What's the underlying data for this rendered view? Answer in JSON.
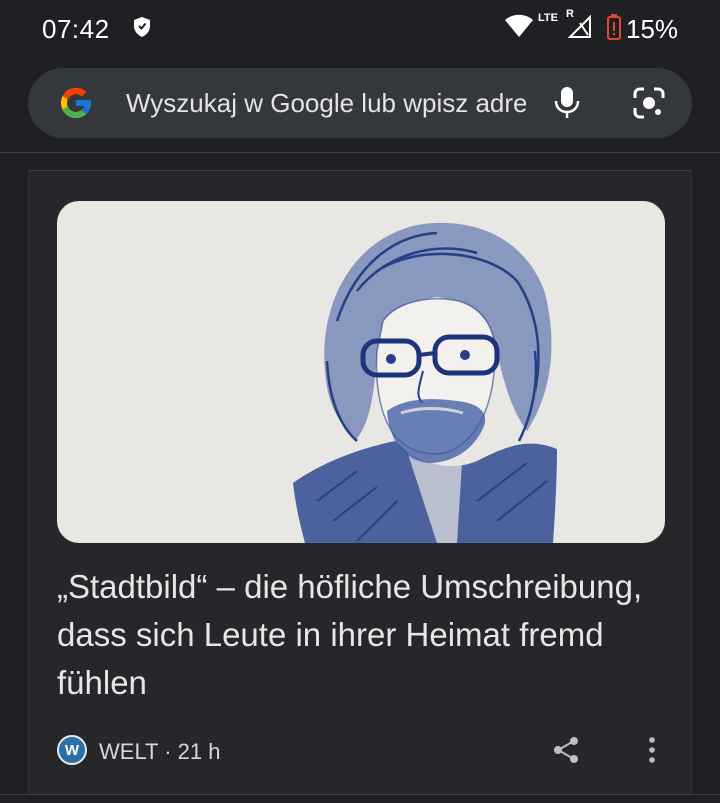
{
  "status_bar": {
    "time": "07:42",
    "network": "LTE",
    "roaming": "R",
    "battery": "15%",
    "icons": [
      "shield-icon",
      "wifi-icon",
      "signal-icon",
      "battery-low-icon"
    ]
  },
  "search": {
    "placeholder": "Wyszukaj w Google lub wpisz adres URL",
    "icons": [
      "google-logo",
      "mic-icon",
      "lens-icon"
    ]
  },
  "card": {
    "headline": "„Stadtbild“ – die höfliche Umschreibung, dass sich Leute in ihrer Heimat fremd fühlen",
    "source_logo": "W",
    "source": "WELT · 21 h",
    "icons": [
      "share-icon",
      "more-vert-icon"
    ]
  },
  "colors": {
    "background": "#1f2023",
    "search_bg": "#34373c",
    "card_bg": "#25272a",
    "battery_low": "#e2473a",
    "welt_blue": "#2c6ea6",
    "sketch_ink": "#263f86"
  }
}
